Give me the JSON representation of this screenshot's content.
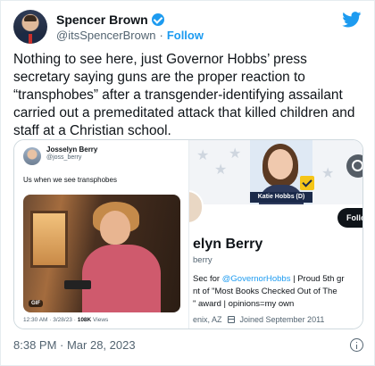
{
  "author": {
    "name": "Spencer Brown",
    "handle": "@itsSpencerBrown",
    "separator": "·",
    "follow_label": "Follow"
  },
  "tweet": {
    "text": "Nothing to see here, just Governor Hobbs’ press secretary saying guns are the proper reaction to “transphobes” after a transgender-identifying assailant carried out a premeditated attack that killed children and staff at a Christian school.",
    "timestamp": "8:38 PM · Mar 28, 2023"
  },
  "embedded_tweet": {
    "name": "Josselyn Berry",
    "handle": "@joss_berry",
    "text": "Us when we see transphobes",
    "gif_badge": "GIF",
    "meta_time": "12:30 AM · 3/28/23 · ",
    "meta_views": "108K",
    "meta_views_label": " Views"
  },
  "profile": {
    "banner_label": "Katie Hobbs (D)",
    "follow_button": "Follo",
    "name": "elyn Berry",
    "handle": "berry",
    "bio_line1_prefix": "Sec for ",
    "bio_line1_link": "@GovernorHobbs",
    "bio_line1_suffix": " | Proud 5th gr",
    "bio_line2": "nt of \"Most Books Checked Out of The",
    "bio_line3": "\" award | opinions=my own",
    "location": "enix, AZ",
    "joined": "Joined September 2011"
  },
  "colors": {
    "accent": "#1d9bf0",
    "text": "#0f1419",
    "muted": "#536471"
  },
  "icons": [
    "verified-badge-icon",
    "twitter-bird-icon",
    "search-icon",
    "calendar-icon",
    "info-icon"
  ]
}
